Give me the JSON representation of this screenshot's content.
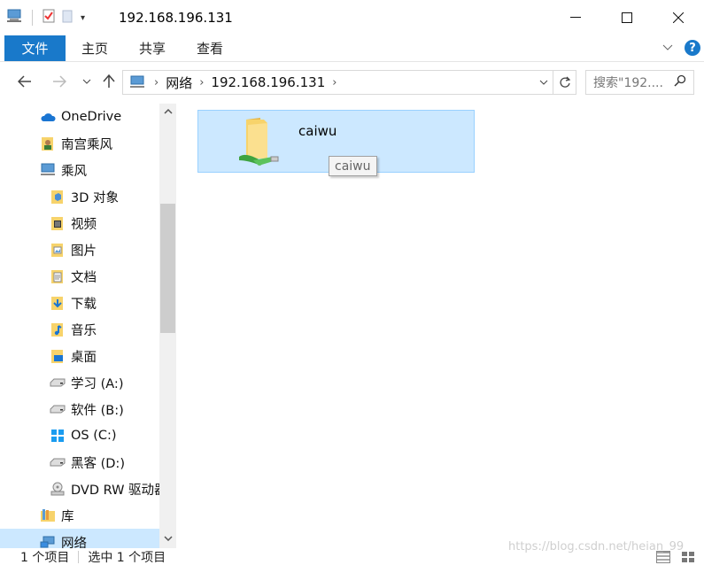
{
  "window": {
    "title": "192.168.196.131"
  },
  "ribbon": {
    "tabs": {
      "file": "文件",
      "home": "主页",
      "share": "共享",
      "view": "查看"
    }
  },
  "address": {
    "crumbs": [
      "网络",
      "192.168.196.131"
    ]
  },
  "search": {
    "placeholder": "搜索\"192...."
  },
  "sidebar": {
    "items": [
      {
        "label": "OneDrive",
        "icon": "cloud-icon"
      },
      {
        "label": "南宫乘风",
        "icon": "user-folder-icon"
      },
      {
        "label": "乘风",
        "icon": "computer-icon"
      },
      {
        "label": "3D 对象",
        "icon": "3d-objects-icon"
      },
      {
        "label": "视频",
        "icon": "videos-icon"
      },
      {
        "label": "图片",
        "icon": "pictures-icon"
      },
      {
        "label": "文档",
        "icon": "documents-icon"
      },
      {
        "label": "下载",
        "icon": "downloads-icon"
      },
      {
        "label": "音乐",
        "icon": "music-icon"
      },
      {
        "label": "桌面",
        "icon": "desktop-icon"
      },
      {
        "label": "学习 (A:)",
        "icon": "drive-icon"
      },
      {
        "label": "软件 (B:)",
        "icon": "drive-icon"
      },
      {
        "label": "OS (C:)",
        "icon": "windows-drive-icon"
      },
      {
        "label": "黑客 (D:)",
        "icon": "drive-icon"
      },
      {
        "label": "DVD RW 驱动器",
        "icon": "dvd-drive-icon"
      },
      {
        "label": "库",
        "icon": "library-icon"
      },
      {
        "label": "网络",
        "icon": "network-icon"
      }
    ]
  },
  "content": {
    "items": [
      {
        "name": "caiwu",
        "tooltip": "caiwu",
        "icon": "shared-folder-icon"
      }
    ]
  },
  "status": {
    "count": "1 个项目",
    "selected": "选中 1 个项目"
  },
  "watermark": "https://blog.csdn.net/heian_99",
  "colors": {
    "accent": "#1979ca",
    "selection": "#cce8ff",
    "selection_border": "#99d1ff",
    "folder": "#f7d36b"
  }
}
